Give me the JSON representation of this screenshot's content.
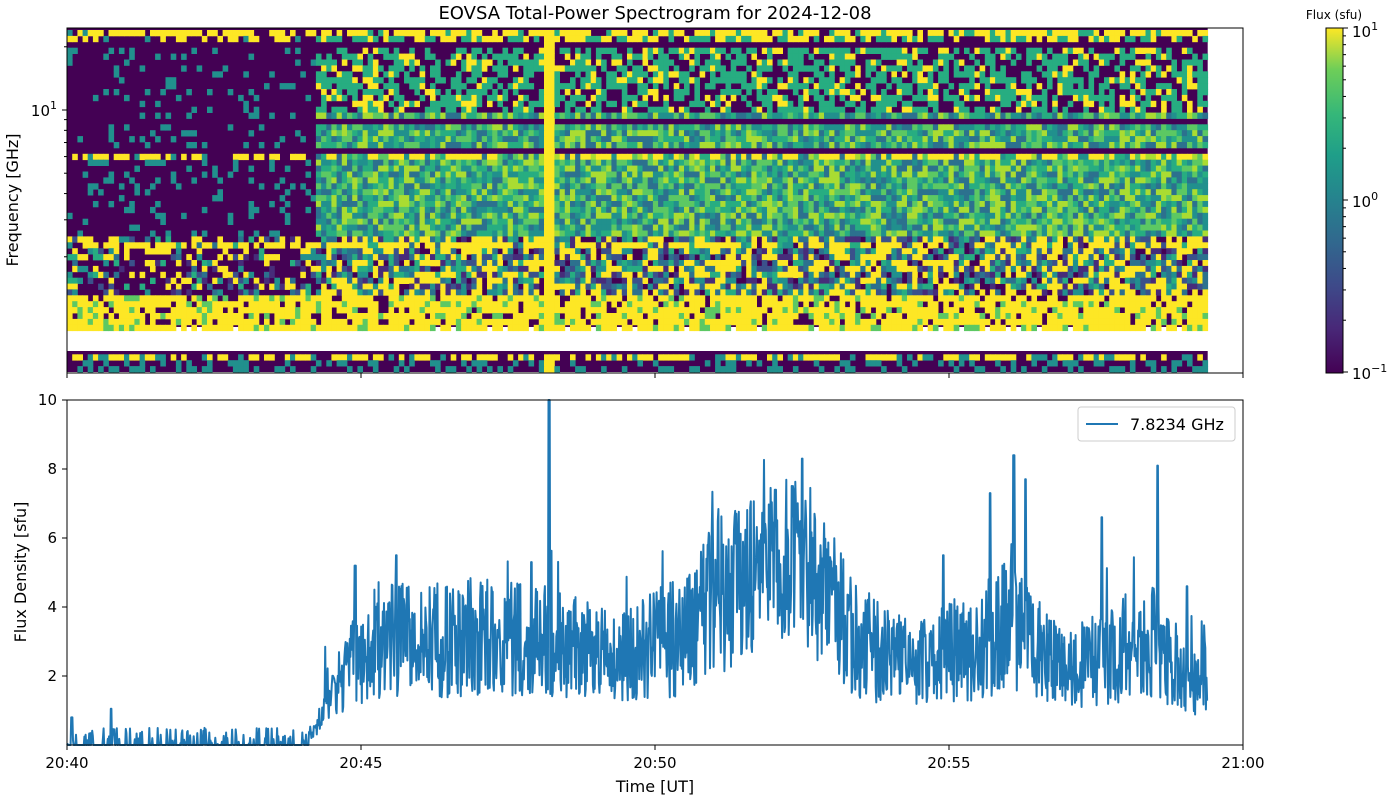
{
  "chart_data": [
    {
      "type": "heatmap",
      "title": "EOVSA Total-Power Spectrogram for 2024-12-08",
      "ylabel": "Frequency [GHz]",
      "y_scale": "log",
      "y_tick_labels": [
        {
          "base": "10",
          "exp": "1"
        }
      ],
      "x_range_minutes": [
        0,
        20
      ],
      "data_ends_minute": 19.4,
      "colorbar": {
        "label": "Flux (sfu)",
        "scale": "log",
        "range": [
          0.1,
          10
        ],
        "colormap": "viridis",
        "tick_labels": [
          {
            "base": "10",
            "exp": "1"
          },
          {
            "base": "10",
            "exp": "0"
          },
          {
            "base": "10",
            "exp": "−1"
          }
        ]
      },
      "features": {
        "burst_onset_minute": 4.2,
        "spike_minute": 8.2,
        "saturated_low_band": true,
        "data_gap_band": true
      }
    },
    {
      "type": "line",
      "xlabel": "Time [UT]",
      "ylabel": "Flux Density [sfu]",
      "ylim": [
        0,
        10
      ],
      "y_ticks": [
        2,
        4,
        6,
        8,
        10
      ],
      "x_tick_labels": [
        "20:40",
        "20:45",
        "20:50",
        "20:55",
        "21:00"
      ],
      "x_ticks_minutes": [
        0,
        5,
        10,
        15,
        20
      ],
      "series": [
        {
          "name": "7.8234 GHz",
          "color": "#1f77b4",
          "envelope": {
            "minutes": [
              0,
              1,
              2,
              3,
              4,
              4.3,
              4.6,
              5,
              5.5,
              6,
              6.5,
              7,
              7.5,
              8,
              8.5,
              9,
              9.5,
              10,
              10.5,
              11,
              11.5,
              12,
              12.3,
              12.6,
              13,
              13.5,
              14,
              14.5,
              15,
              15.5,
              16,
              16.5,
              17,
              17.5,
              18,
              18.5,
              19,
              19.4
            ],
            "values": [
              0,
              0.1,
              0.05,
              0,
              0,
              0.8,
              1.8,
              2.6,
              3.0,
              3.1,
              3.0,
              3.2,
              3.1,
              3.0,
              2.9,
              2.6,
              2.6,
              2.9,
              3.2,
              4.2,
              4.8,
              5.2,
              5.5,
              5.1,
              4.0,
              3.0,
              2.5,
              2.3,
              2.7,
              2.9,
              3.5,
              2.8,
              2.1,
              2.5,
              2.6,
              3.0,
              1.8,
              2.0
            ]
          },
          "peaks": [
            {
              "minute": 0.08,
              "value": 0.8
            },
            {
              "minute": 0.75,
              "value": 1.05
            },
            {
              "minute": 4.9,
              "value": 5.2
            },
            {
              "minute": 5.6,
              "value": 5.5
            },
            {
              "minute": 7.9,
              "value": 5.3
            },
            {
              "minute": 8.2,
              "value": 10.0
            },
            {
              "minute": 10.9,
              "value": 5.8
            },
            {
              "minute": 12.05,
              "value": 7.4
            },
            {
              "minute": 12.4,
              "value": 6.9
            },
            {
              "minute": 12.5,
              "value": 8.3
            },
            {
              "minute": 14.9,
              "value": 5.5
            },
            {
              "minute": 15.7,
              "value": 7.3
            },
            {
              "minute": 16.1,
              "value": 8.4
            },
            {
              "minute": 16.3,
              "value": 7.7
            },
            {
              "minute": 17.6,
              "value": 6.6
            },
            {
              "minute": 18.55,
              "value": 8.1
            },
            {
              "minute": 19.05,
              "value": 4.6
            }
          ]
        }
      ]
    }
  ]
}
